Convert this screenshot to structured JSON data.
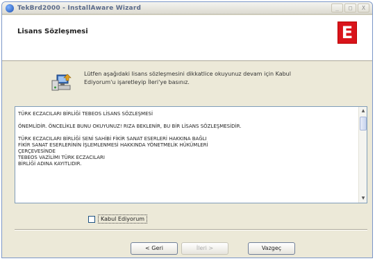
{
  "window": {
    "title": "TekBrd2000 - InstallAware Wizard",
    "controls": [
      "_",
      "□",
      "X"
    ]
  },
  "header": {
    "title": "Lisans Sözleşmesi",
    "logo_letter": "E",
    "logo_color": "#d9141b"
  },
  "instruction": "Lütfen aşağıdaki lisans sözleşmesini dikkatlice okuyunuz devam için Kabul Ediyorum'u işaretleyip İleri'ye basınız.",
  "license": {
    "lines": [
      "TÜRK ECZACILARI BİRLİĞİ TEBEOS LİSANS SÖZLEŞMESİ",
      "ÖNEMLİDİR. ÖNCELİKLE BUNU OKUYUNUZ! RIZA BEKLENİR, BU BİR LİSANS SÖZLEŞMESİDİR.",
      "TÜRK ECZACILARI BİRLİĞİ SENİ SAHİBİ FİKİR SANAT ESERLERİ HAKKINA BAĞLI",
      "FİKİR SANAT ESERLERİNİN İŞLEMLENMESİ HAKKINDA YÖNETMELİK HÜKÜMLERİ",
      "ÇERÇEVESİNDE",
      "TEBEOS VAZİLİMI TÜRK ECZACILARI",
      "BİRLİĞİ ADINA KAYITLIDIR."
    ]
  },
  "accept_label": "Kabul Ediyorum",
  "buttons": {
    "back": "< Geri",
    "next": "İleri >",
    "cancel": "Vazgeç"
  },
  "icons": {
    "instruction": "setup-computer-icon"
  }
}
